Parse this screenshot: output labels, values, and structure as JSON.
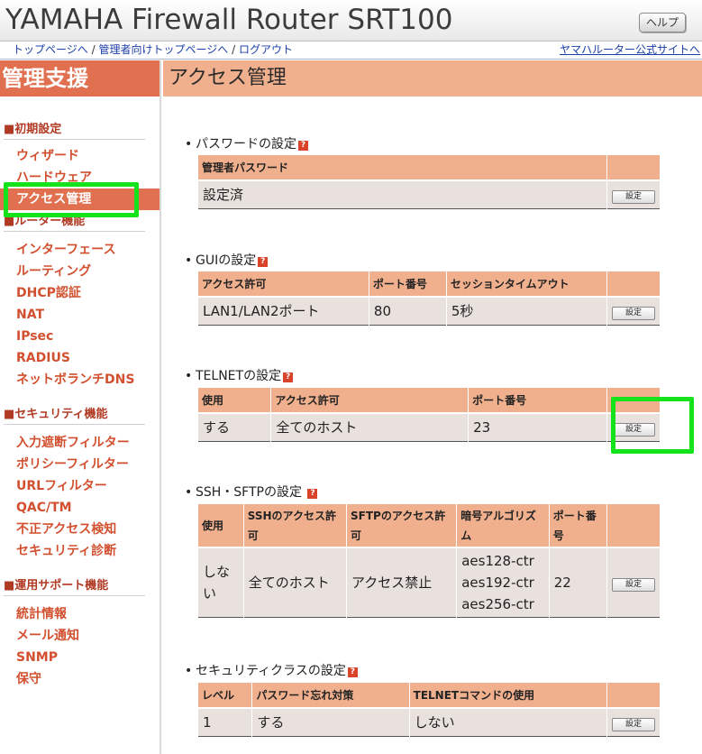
{
  "header": {
    "title": "YAMAHA Firewall Router SRT100",
    "help_label": "ヘルプ"
  },
  "linkbar": {
    "links": [
      "トップページへ",
      "管理者向けトップページへ",
      "ログアウト"
    ],
    "separator": "/",
    "yamaha_link": "ヤマハルーター公式サイトへ"
  },
  "sidebar": {
    "title": "管理支援",
    "sections": [
      {
        "heading": "■初期設定",
        "items": [
          "ウィザード",
          "ハードウェア",
          "アクセス管理"
        ]
      },
      {
        "heading": "■ルーター機能",
        "items": [
          "インターフェース",
          "ルーティング",
          "DHCP認証",
          "NAT",
          "IPsec",
          "RADIUS",
          "ネットボランチDNS"
        ]
      },
      {
        "heading": "■セキュリティ機能",
        "items": [
          "入力遮断フィルター",
          "ポリシーフィルター",
          "URLフィルター",
          "QAC/TM",
          "不正アクセス検知",
          "セキュリティ診断"
        ]
      },
      {
        "heading": "■運用サポート機能",
        "items": [
          "統計情報",
          "メール通知",
          "SNMP",
          "保守"
        ]
      }
    ],
    "active_item": "アクセス管理"
  },
  "main": {
    "page_title": "アクセス管理",
    "bullet": "•",
    "help_icon": "?",
    "set_label": "設定",
    "password": {
      "heading": "パスワードの設定",
      "headers": [
        "管理者パスワード",
        ""
      ],
      "row": [
        "設定済"
      ]
    },
    "gui": {
      "heading": "GUIの設定",
      "headers": [
        "アクセス許可",
        "ポート番号",
        "セッションタイムアウト",
        ""
      ],
      "row": [
        "LAN1/LAN2ポート",
        "80",
        "5秒"
      ]
    },
    "telnet": {
      "heading": "TELNETの設定",
      "headers": [
        "使用",
        "アクセス許可",
        "ポート番号",
        ""
      ],
      "row": [
        "する",
        "全てのホスト",
        "23"
      ]
    },
    "ssh": {
      "heading": "SSH・SFTPの設定",
      "headers": [
        "使用",
        "SSHのアクセス許可",
        "SFTPのアクセス許可",
        "暗号アルゴリズム",
        "ポート番号",
        ""
      ],
      "row": [
        "しない",
        "全てのホスト",
        "アクセス禁止",
        [
          "aes128-ctr",
          "aes192-ctr",
          "aes256-ctr"
        ],
        "22"
      ]
    },
    "security_class": {
      "heading": "セキュリティクラスの設定",
      "headers": [
        "レベル",
        "パスワード忘れ対策",
        "TELNETコマンドの使用",
        ""
      ],
      "row": [
        "1",
        "する",
        "しない"
      ]
    }
  },
  "highlight_color": "#14e31b",
  "accent_color": "#e0704f",
  "header_color": "#f0b08e"
}
